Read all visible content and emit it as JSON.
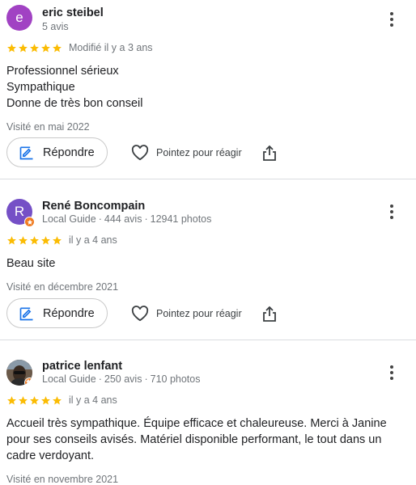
{
  "colors": {
    "star": "#fbbc04",
    "avatar_eric": "#a142c3",
    "avatar_rene": "#7550c6",
    "local_guide_badge": "#f07c22",
    "reply_icon": "#1a73e8"
  },
  "icons": [
    "star-icon",
    "reply-icon",
    "heart-icon",
    "share-icon",
    "more-vert-icon",
    "local-guide-badge-icon"
  ],
  "actions": {
    "reply_label": "Répondre",
    "like_label": "Pointez pour réagir"
  },
  "reviews": [
    {
      "avatar_letter": "e",
      "name": "eric steibel",
      "meta": "5 avis",
      "rating": 5,
      "date": "Modifié il y a 3 ans",
      "text": [
        "Professionnel sérieux",
        "Sympathique",
        "Donne de très bon conseil"
      ],
      "visited": "Visité en mai 2022"
    },
    {
      "avatar_letter": "R",
      "name": "René Boncompain",
      "meta_guide": "Local Guide",
      "meta_reviews": "444 avis",
      "meta_photos": "12941 photos",
      "rating": 5,
      "date": "il y a 4 ans",
      "text": [
        "Beau site"
      ],
      "visited": "Visité en décembre 2021"
    },
    {
      "name": "patrice lenfant",
      "meta_guide": "Local Guide",
      "meta_reviews": "250 avis",
      "meta_photos": "710 photos",
      "rating": 5,
      "date": "il y a 4 ans",
      "text": [
        "Accueil très sympathique. Équipe efficace et chaleureuse. Merci à Janine pour ses conseils avisés. Matériel disponible performant, le tout dans un cadre verdoyant."
      ],
      "visited": "Visité en novembre 2021"
    }
  ]
}
